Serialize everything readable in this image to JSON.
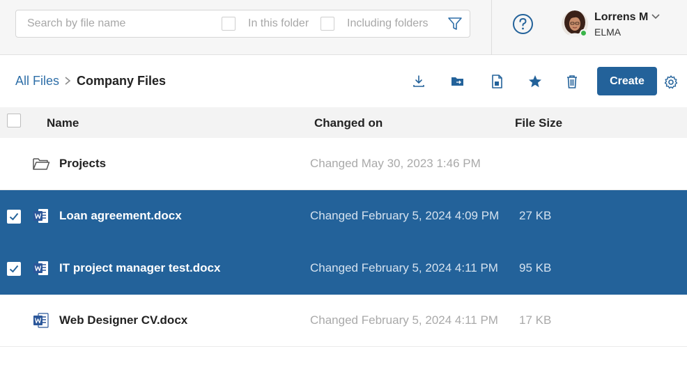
{
  "search": {
    "placeholder": "Search by file name",
    "option_in_folder": "In this folder",
    "option_including_folders": "Including folders"
  },
  "user": {
    "name": "Lorrens M",
    "org": "ELMA",
    "status": "online"
  },
  "breadcrumb": {
    "root": "All Files",
    "current": "Company Files"
  },
  "toolbar": {
    "icons": [
      "download-icon",
      "move-folder-icon",
      "file-icon",
      "star-icon",
      "trash-icon",
      "gear-icon"
    ],
    "create_label": "Create"
  },
  "table": {
    "columns": [
      "Name",
      "Changed on",
      "File Size"
    ],
    "rows": [
      {
        "type": "folder",
        "name": "Projects",
        "changed": "Changed May 30, 2023 1:46 PM",
        "size": "",
        "selected": false
      },
      {
        "type": "docx",
        "name": "Loan agreement.docx",
        "changed": "Changed February 5, 2024 4:09 PM",
        "size": "27 KB",
        "selected": true
      },
      {
        "type": "docx",
        "name": "IT project manager test.docx",
        "changed": "Changed February 5, 2024 4:11 PM",
        "size": "95 KB",
        "selected": true
      },
      {
        "type": "docx",
        "name": "Web Designer CV.docx",
        "changed": "Changed February 5, 2024 4:11 PM",
        "size": "17 KB",
        "selected": false
      }
    ]
  },
  "colors": {
    "accent": "#23629a",
    "link": "#2f6fa8",
    "online": "#3ab54a"
  }
}
